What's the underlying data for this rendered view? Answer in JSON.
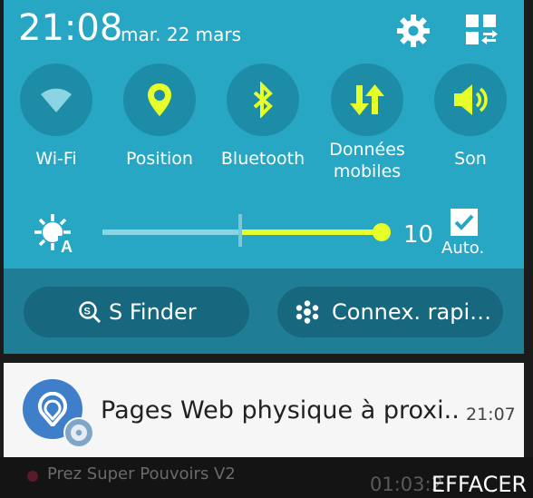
{
  "status": {
    "time": "21:08",
    "date": "mar. 22 mars",
    "icons": [
      "gear-icon",
      "grid-edit-icon"
    ]
  },
  "quick_settings": [
    {
      "label": "Wi-Fi",
      "icon": "wifi-icon",
      "active": false
    },
    {
      "label": "Position",
      "icon": "location-pin-icon",
      "active": true
    },
    {
      "label": "Bluetooth",
      "icon": "bluetooth-icon",
      "active": true
    },
    {
      "label": "Données\nmobiles",
      "label_line1": "Données",
      "label_line2": "mobiles",
      "icon": "mobile-data-icon",
      "active": true
    },
    {
      "label": "Son",
      "icon": "speaker-icon",
      "active": true
    }
  ],
  "brightness": {
    "value": "10",
    "level": 1.0,
    "auto_label": "Auto.",
    "auto_checked": true
  },
  "actions": {
    "sfinder": "S Finder",
    "quick_connect": "Connex. rapi…"
  },
  "notification": {
    "title": "Pages Web physique à proxi..",
    "time": "21:07"
  },
  "background": {
    "media_title": "Prez Super Pouvoirs V2",
    "media_time": "01:03:2",
    "clear_label": "EFFACER"
  },
  "colors": {
    "panel": "#27a7c4",
    "toggle_bg": "#1d8ca6",
    "accent": "#e6ff2a",
    "inactive_icon": "#8ad4e4",
    "actions_bg": "#1f7d95",
    "pill_bg": "#17687e"
  }
}
